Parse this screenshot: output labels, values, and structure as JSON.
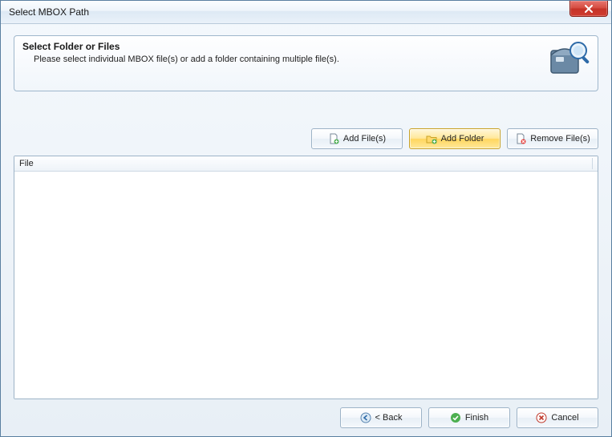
{
  "window": {
    "title": "Select MBOX Path"
  },
  "info": {
    "heading": "Select Folder or Files",
    "description": "Please select individual MBOX file(s) or add a folder containing multiple file(s)."
  },
  "toolbar": {
    "add_files_label": "Add File(s)",
    "add_folder_label": "Add Folder",
    "remove_files_label": "Remove File(s)"
  },
  "file_list": {
    "column_header": "File",
    "rows": []
  },
  "footer": {
    "back_label": "< Back",
    "finish_label": "Finish",
    "cancel_label": "Cancel"
  }
}
